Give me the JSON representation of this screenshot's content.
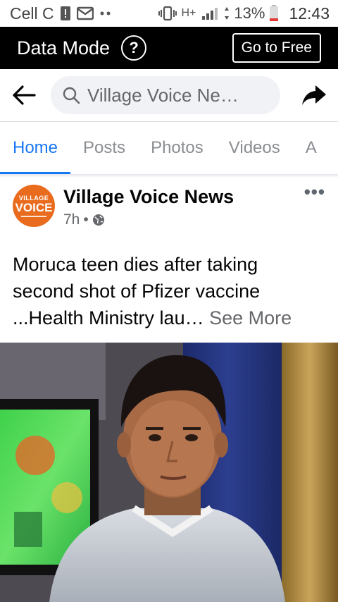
{
  "status_bar": {
    "carrier": "Cell C",
    "network": "H+",
    "battery": "13%",
    "time": "12:43"
  },
  "data_mode_bar": {
    "title": "Data Mode",
    "help_symbol": "?",
    "go_free_label": "Go to Free"
  },
  "search": {
    "text": "Village Voice Ne…"
  },
  "tabs": [
    {
      "label": "Home",
      "active": true
    },
    {
      "label": "Posts",
      "active": false
    },
    {
      "label": "Photos",
      "active": false
    },
    {
      "label": "Videos",
      "active": false
    },
    {
      "label": "A",
      "active": false
    }
  ],
  "post": {
    "avatar_top": "VILLAGE",
    "avatar_main": "VOICE",
    "page_name": "Village Voice News",
    "time": "7h",
    "separator": "•",
    "more": "•••",
    "text_line1": "Moruca teen dies after taking",
    "text_line2": "second shot of  Pfizer vaccine",
    "text_line3": "...Health Ministry lau… ",
    "see_more": "See More"
  },
  "colors": {
    "accent": "#1877f2",
    "avatar_orange": "#e96b1d",
    "data_bar": "#000000"
  }
}
